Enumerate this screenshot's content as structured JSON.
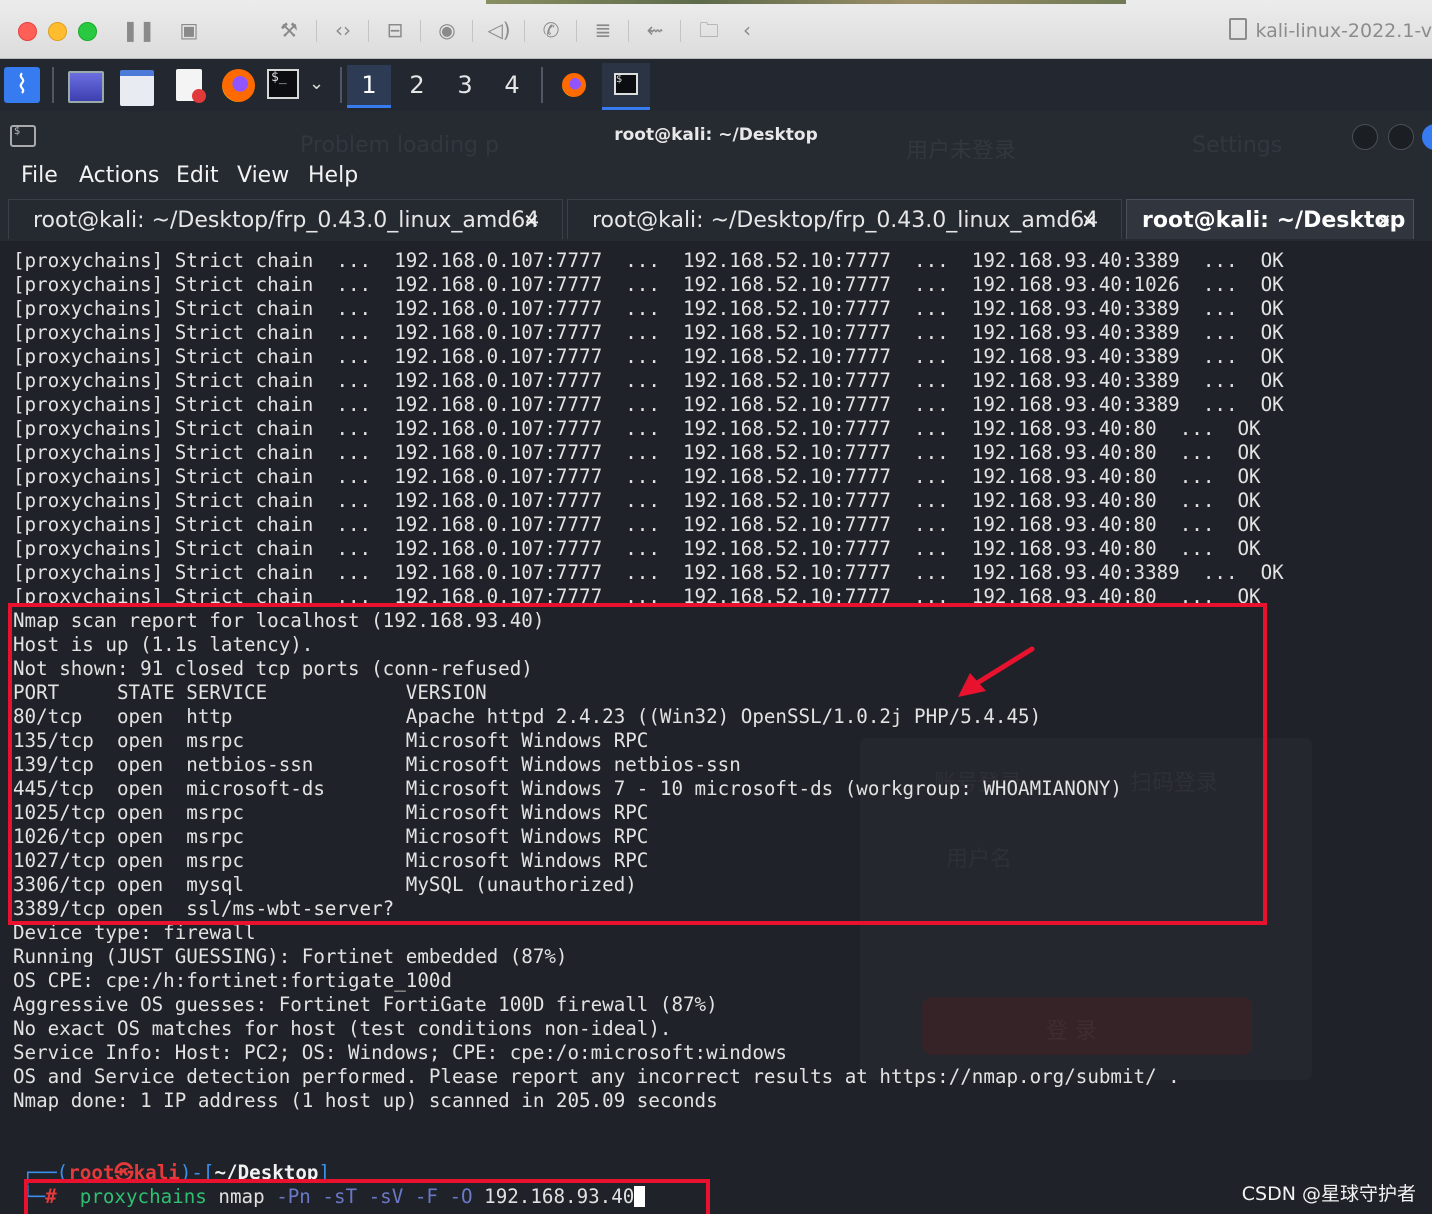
{
  "vm": {
    "title": "kali-linux-2022.1-v"
  },
  "panel": {
    "workspaces": [
      "1",
      "2",
      "3",
      "4"
    ],
    "active_workspace": "1"
  },
  "window": {
    "title": "root@kali: ~/Desktop"
  },
  "menu": [
    "File",
    "Actions",
    "Edit",
    "View",
    "Help"
  ],
  "tabs": [
    {
      "label": "root@kali: ~/Desktop/frp_0.43.0_linux_amd64",
      "active": false
    },
    {
      "label": "root@kali: ~/Desktop/frp_0.43.0_linux_amd64",
      "active": false
    },
    {
      "label": "root@kali: ~/Desktop",
      "active": true
    }
  ],
  "terminal": {
    "proxychains_lines": [
      "[proxychains] Strict chain  ...  192.168.0.107:7777  ...  192.168.52.10:7777  ...  192.168.93.40:3389  ...  OK",
      "[proxychains] Strict chain  ...  192.168.0.107:7777  ...  192.168.52.10:7777  ...  192.168.93.40:1026  ...  OK",
      "[proxychains] Strict chain  ...  192.168.0.107:7777  ...  192.168.52.10:7777  ...  192.168.93.40:3389  ...  OK",
      "[proxychains] Strict chain  ...  192.168.0.107:7777  ...  192.168.52.10:7777  ...  192.168.93.40:3389  ...  OK",
      "[proxychains] Strict chain  ...  192.168.0.107:7777  ...  192.168.52.10:7777  ...  192.168.93.40:3389  ...  OK",
      "[proxychains] Strict chain  ...  192.168.0.107:7777  ...  192.168.52.10:7777  ...  192.168.93.40:3389  ...  OK",
      "[proxychains] Strict chain  ...  192.168.0.107:7777  ...  192.168.52.10:7777  ...  192.168.93.40:3389  ...  OK",
      "[proxychains] Strict chain  ...  192.168.0.107:7777  ...  192.168.52.10:7777  ...  192.168.93.40:80  ...  OK",
      "[proxychains] Strict chain  ...  192.168.0.107:7777  ...  192.168.52.10:7777  ...  192.168.93.40:80  ...  OK",
      "[proxychains] Strict chain  ...  192.168.0.107:7777  ...  192.168.52.10:7777  ...  192.168.93.40:80  ...  OK",
      "[proxychains] Strict chain  ...  192.168.0.107:7777  ...  192.168.52.10:7777  ...  192.168.93.40:80  ...  OK",
      "[proxychains] Strict chain  ...  192.168.0.107:7777  ...  192.168.52.10:7777  ...  192.168.93.40:80  ...  OK",
      "[proxychains] Strict chain  ...  192.168.0.107:7777  ...  192.168.52.10:7777  ...  192.168.93.40:80  ...  OK",
      "[proxychains] Strict chain  ...  192.168.0.107:7777  ...  192.168.52.10:7777  ...  192.168.93.40:3389  ...  OK",
      "[proxychains] Strict chain  ...  192.168.0.107:7777  ...  192.168.52.10:7777  ...  192.168.93.40:80  ...  OK"
    ],
    "report_lines": [
      "Nmap scan report for localhost (192.168.93.40)",
      "Host is up (1.1s latency).",
      "Not shown: 91 closed tcp ports (conn-refused)",
      "PORT     STATE SERVICE            VERSION",
      "80/tcp   open  http               Apache httpd 2.4.23 ((Win32) OpenSSL/1.0.2j PHP/5.4.45)",
      "135/tcp  open  msrpc              Microsoft Windows RPC",
      "139/tcp  open  netbios-ssn        Microsoft Windows netbios-ssn",
      "445/tcp  open  microsoft-ds       Microsoft Windows 7 - 10 microsoft-ds (workgroup: WHOAMIANONY)",
      "1025/tcp open  msrpc              Microsoft Windows RPC",
      "1026/tcp open  msrpc              Microsoft Windows RPC",
      "1027/tcp open  msrpc              Microsoft Windows RPC",
      "3306/tcp open  mysql              MySQL (unauthorized)",
      "3389/tcp open  ssl/ms-wbt-server?"
    ],
    "os_lines": [
      "Device type: firewall",
      "Running (JUST GUESSING): Fortinet embedded (87%)",
      "OS CPE: cpe:/h:fortinet:fortigate_100d",
      "Aggressive OS guesses: Fortinet FortiGate 100D firewall (87%)",
      "No exact OS matches for host (test conditions non-ideal).",
      "Service Info: Host: PC2; OS: Windows; CPE: cpe:/o:microsoft:windows",
      "",
      "OS and Service detection performed. Please report any incorrect results at https://nmap.org/submit/ .",
      "Nmap done: 1 IP address (1 host up) scanned in 205.09 seconds"
    ],
    "prompt": {
      "user_host": "root㉿kali",
      "cwd": "~/Desktop",
      "symbol": "#",
      "command": "proxychains",
      "tool": "nmap",
      "options": "-Pn -sT -sV -F -O",
      "target": "192.168.93.40"
    }
  },
  "background_ghost": {
    "tab_problem": "Problem loading p",
    "tab_user": "用户未登录",
    "tab_settings": "Settings",
    "login_tab": "账号登录",
    "login_tab2": "扫码登录",
    "username_placeholder": "用户名",
    "login_button": "登 录"
  },
  "watermark": "CSDN @星球守护者",
  "colors": {
    "highlight": "#e8122e",
    "accent": "#367bf0",
    "prompt_red": "#e63a3a",
    "command_green": "#2fbf71"
  }
}
